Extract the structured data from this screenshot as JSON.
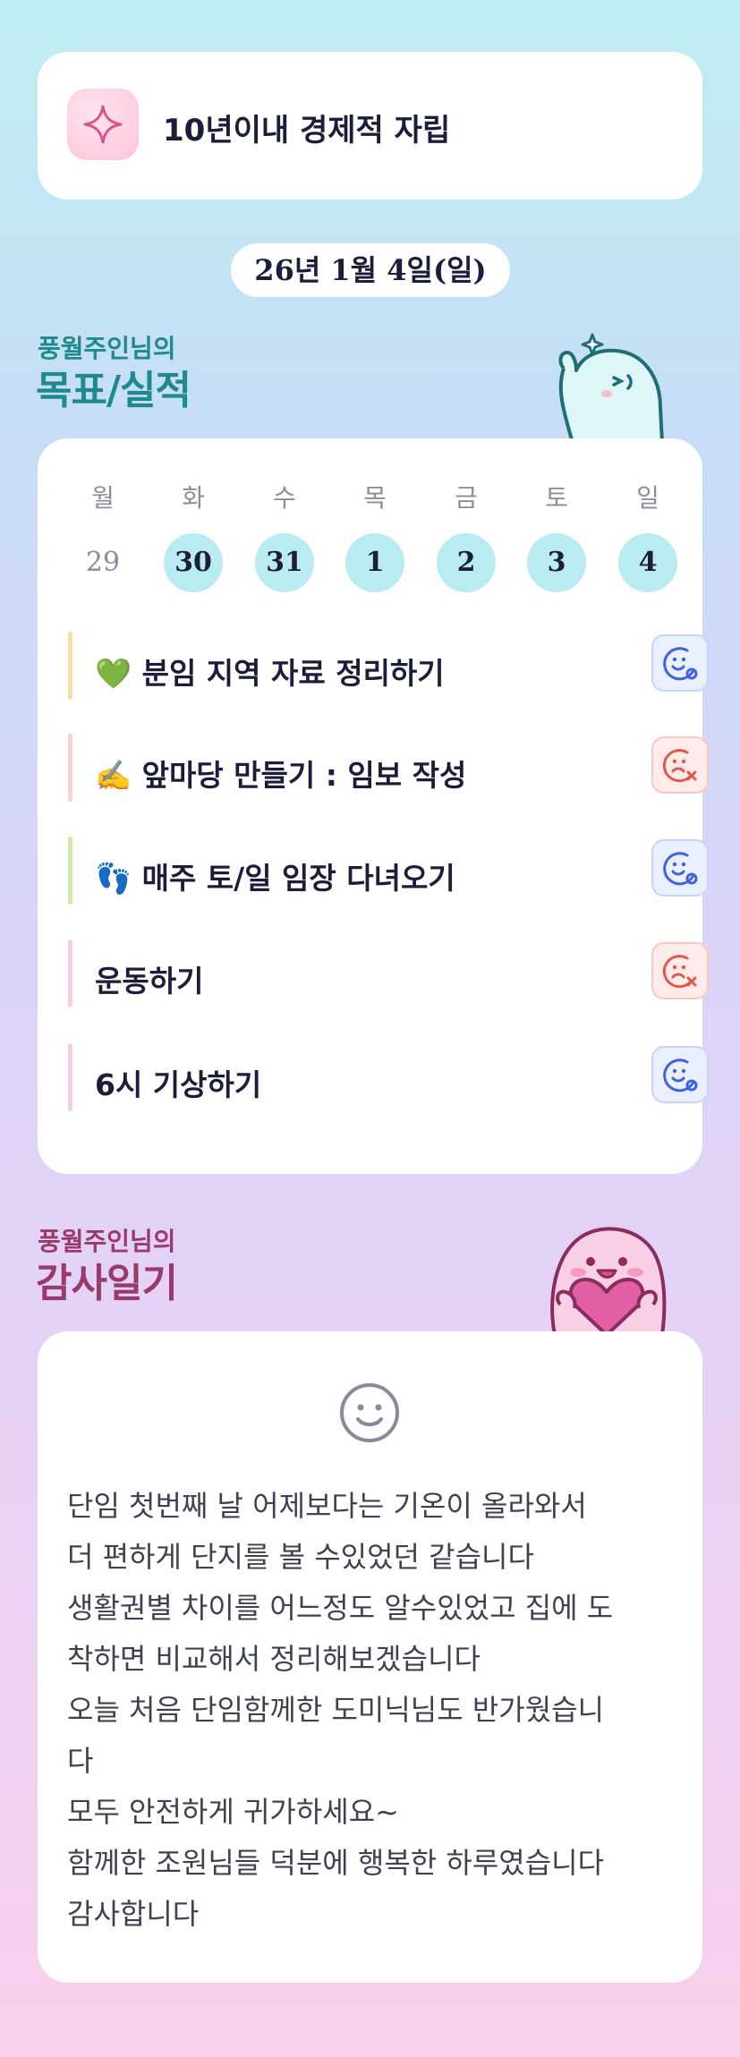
{
  "goal": {
    "icon": "sparkle-icon",
    "title": "10년이내 경제적 자립"
  },
  "date": "26년 1월 4일(일)",
  "performance": {
    "subtitle": "풍월주인님의",
    "title": "목표/실적"
  },
  "calendar": {
    "weekdays": [
      "월",
      "화",
      "수",
      "목",
      "금",
      "토",
      "일"
    ],
    "days": [
      {
        "num": "29",
        "active": false
      },
      {
        "num": "30",
        "active": true
      },
      {
        "num": "31",
        "active": true
      },
      {
        "num": "1",
        "active": true
      },
      {
        "num": "2",
        "active": true
      },
      {
        "num": "3",
        "active": true
      },
      {
        "num": "4",
        "active": true
      }
    ]
  },
  "tasks": [
    {
      "label": "💚 분임 지역 자료 정리하기",
      "status": "done",
      "bar_color": "#f5dfa3"
    },
    {
      "label": "✍️ 앞마당 만들기 : 임보 작성",
      "status": "fail",
      "bar_color": "#f8d3cd"
    },
    {
      "label": "👣 매주 토/일 임장 다녀오기",
      "status": "done",
      "bar_color": "#cfe9a8"
    },
    {
      "label": "운동하기",
      "status": "fail",
      "bar_color": "#f4cde6"
    },
    {
      "label": "6시 기상하기",
      "status": "done",
      "bar_color": "#f4cde6"
    }
  ],
  "gratitude": {
    "subtitle": "풍월주인님의",
    "title": "감사일기",
    "icon": "smile-icon",
    "lines": [
      "단임 첫번째 날 어제보다는 기온이 올라와서",
      "더 편하게 단지를 볼 수있었던 같습니다",
      "생활권별 차이를 어느정도 알수있었고 집에 도",
      "착하면 비교해서 정리해보겠습니다",
      "오늘 처음 단임함께한 도미닉님도 반가웠습니",
      "다",
      "모두 안전하게 귀가하세요~",
      "함께한 조원님들 덕분에 행복한 하루였습니다",
      "감사합니다"
    ]
  },
  "colors": {
    "teal": "#1f8a8e",
    "maroon": "#9a3a6c",
    "done": "#3d63e0",
    "fail": "#e2574c",
    "active_day": "#b9ecf1"
  }
}
